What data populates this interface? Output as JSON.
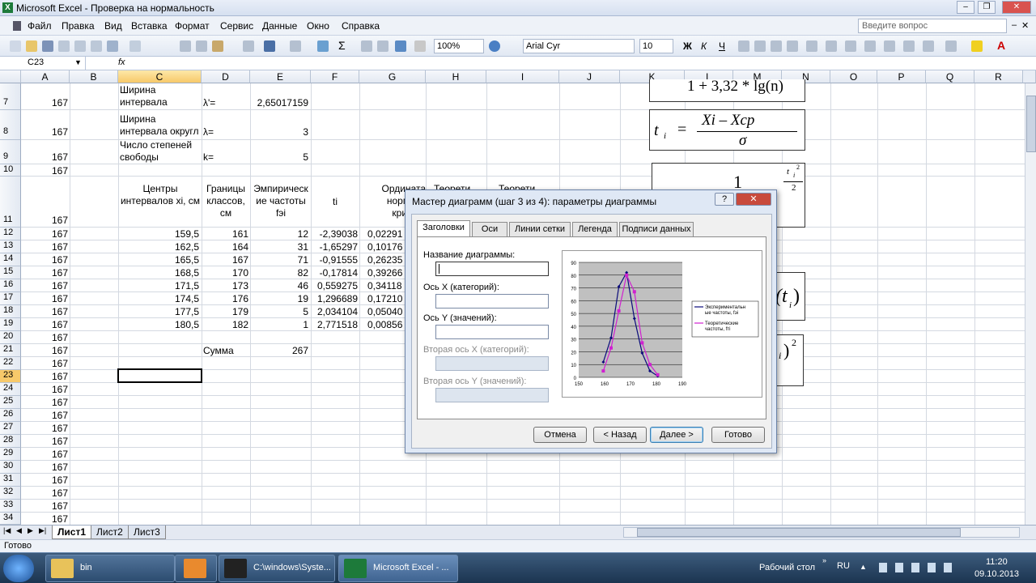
{
  "window": {
    "title": "Microsoft Excel - Проверка на нормальность",
    "icon": "excel-icon"
  },
  "menu": [
    "Файл",
    "Правка",
    "Вид",
    "Вставка",
    "Формат",
    "Сервис",
    "Данные",
    "Окно",
    "Справка"
  ],
  "question_box": "Введите вопрос",
  "toolbar": {
    "zoom": "100%",
    "font": "Arial Cyr",
    "size": "10"
  },
  "namebox": "C23",
  "fx": "fx",
  "columns": [
    "A",
    "B",
    "C",
    "D",
    "E",
    "F",
    "G",
    "H",
    "I",
    "J",
    "K",
    "L",
    "M",
    "N",
    "O",
    "P",
    "Q",
    "R"
  ],
  "rows": {
    "7": "7",
    "8": "8",
    "9": "9",
    "10": "10",
    "11": "11",
    "12": "12",
    "13": "13",
    "14": "14",
    "15": "15",
    "16": "16",
    "17": "17",
    "18": "18",
    "19": "19",
    "20": "20",
    "21": "21",
    "22": "22",
    "23": "23",
    "24": "24",
    "25": "25",
    "26": "26",
    "27": "27",
    "28": "28",
    "29": "29",
    "30": "30",
    "31": "31",
    "32": "32",
    "33": "33",
    "34": "34"
  },
  "cells": {
    "a": "167",
    "c7": "Ширина интервала",
    "d7": "λ'=",
    "e7": "2,65017159",
    "c8": "Ширина интервала округл",
    "d8": "λ=",
    "e8": "3",
    "c9": "Число степеней свободы",
    "d9": "k=",
    "e9": "5",
    "c11": "Центры интервалов xi, см",
    "d11": "Границы классов, см",
    "e11": "Эмпирическ ие частоты fэi",
    "f11": "ti",
    "g11": "Ордината нормаль кривой,",
    "h11": "Теорети",
    "i11": "Теорети",
    "c_vals": [
      "159,5",
      "162,5",
      "165,5",
      "168,5",
      "171,5",
      "174,5",
      "177,5",
      "180,5"
    ],
    "d_vals": [
      "161",
      "164",
      "167",
      "170",
      "173",
      "176",
      "179",
      "182"
    ],
    "e_vals": [
      "12",
      "31",
      "71",
      "82",
      "46",
      "19",
      "5",
      "1"
    ],
    "f_vals": [
      "-2,39038",
      "-1,65297",
      "-0,91555",
      "-0,17814",
      "0,559275",
      "1,296689",
      "2,034104",
      "2,771518"
    ],
    "g_vals": [
      "0,02291",
      "0,10176",
      "0,26235",
      "0,39266",
      "0,34118",
      "0,17210",
      "0,05040",
      "0,00856"
    ],
    "d21": "Сумма",
    "e21": "267"
  },
  "formulas": {
    "f1": "1 + 3,32 * lg(n)",
    "f2_t": "t",
    "f2_i": "i",
    "f2_eq": "=",
    "f2_num": "Xi  –  Xcp",
    "f2_den": "σ",
    "f3_one": "1",
    "f3_exp": "t",
    "f3_exp_i": "i",
    "f3_two": "2",
    "f3_two_b": "2",
    "f4": "(t",
    "f4_i": "i",
    "f4_close": ")",
    "f5_i": "i",
    "f5_close": ")",
    "f5_sq": "2"
  },
  "sheets": [
    "Лист1",
    "Лист2",
    "Лист3"
  ],
  "status": "Готово",
  "dialog": {
    "title": "Мастер диаграмм (шаг 3 из 4): параметры диаграммы",
    "help": "?",
    "close": "✕",
    "tabs": [
      "Заголовки",
      "Оси",
      "Линии сетки",
      "Легенда",
      "Подписи данных"
    ],
    "fields": {
      "chart_title": "Название диаграммы:",
      "x_axis": "Ось X (категорий):",
      "y_axis": "Ось Y (значений):",
      "x2_axis": "Вторая ось X (категорий):",
      "y2_axis": "Вторая ось Y (значений):"
    },
    "buttons": {
      "cancel": "Отмена",
      "back": "< Назад",
      "next": "Далее >",
      "done": "Готово"
    }
  },
  "chart_data": {
    "type": "line",
    "x": [
      159.5,
      162.5,
      165.5,
      168.5,
      171.5,
      174.5,
      177.5,
      180.5
    ],
    "xlim": [
      150,
      190
    ],
    "ylim": [
      0,
      90
    ],
    "xticks": [
      "150",
      "160",
      "170",
      "180",
      "190"
    ],
    "yticks": [
      "0",
      "10",
      "20",
      "30",
      "40",
      "50",
      "60",
      "70",
      "80",
      "90"
    ],
    "series": [
      {
        "name": "Экспериментальные частоты, fэi",
        "color": "#0a0a7a",
        "values": [
          12,
          31,
          71,
          82,
          46,
          19,
          5,
          1
        ]
      },
      {
        "name": "Теоретические частоты, fтi",
        "color": "#d020d0",
        "values": [
          5,
          23,
          52,
          80,
          67,
          27,
          10,
          2
        ]
      }
    ],
    "legend_position": "right",
    "grid": true
  },
  "taskbar": {
    "items": [
      "bin",
      "",
      "C:\\windows\\Syste...",
      "Microsoft Excel - ..."
    ],
    "desktop": "Рабочий стол",
    "lang": "RU",
    "time": "11:20",
    "date": "09.10.2013"
  }
}
